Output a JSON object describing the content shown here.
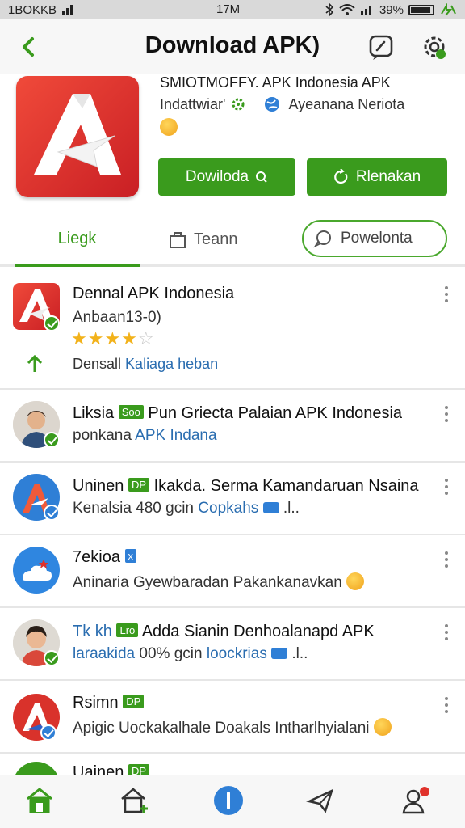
{
  "status_bar": {
    "left": "1BOKKB",
    "center": "17M",
    "right": "39%"
  },
  "app_bar": {
    "title": "Download APK)"
  },
  "app": {
    "name": "SMIOTMOFFY. APK Indonesia APK",
    "developer": "Indattwiar'",
    "category": "Ayeanana Neriota",
    "download_label": "Dowiloda",
    "rename_label": "Rlenakan"
  },
  "tabs": {
    "active": "Liegk",
    "team": "Teann",
    "pill": "Powelonta"
  },
  "list": [
    {
      "title": "Dennal APK Indonesia",
      "sub": "Anbaan13-0)",
      "rating": 4,
      "action": "Densall",
      "action_link": "Kaliaga heban"
    },
    {
      "title_a": "Liksia",
      "tag": "Soo",
      "title_b": "Pun Griecta Palaian APK Indonesia",
      "sub_a": "ponkana",
      "sub_b": "APK Indana"
    },
    {
      "title_a": "Uninen",
      "tag": "DP",
      "title_b": "Ikakda. Serma Kamandaruan Nsaina",
      "sub_a": "Kenalsia 480 gcin",
      "sub_b": "Copkahs",
      "sub_c": ".l.."
    },
    {
      "title_a": "7ekioa",
      "tag": "x",
      "sub": "Aninaria Gyewbaradan Pakankanavkan"
    },
    {
      "title_a": "Tk kh",
      "tag": "Lro",
      "title_b": "Adda Sianin Denhoalanapd APK",
      "sub_a": "laraakida",
      "sub_b": "00% gcin",
      "sub_c": "loockrias",
      "sub_d": ".l.."
    },
    {
      "title_a": "Rsimn",
      "tag": "DP",
      "sub": "Apigic Uockakalhale Doakals Intharlhyialani"
    },
    {
      "title_a": "Uainen",
      "tag": "DP"
    }
  ],
  "colors": {
    "accent": "#3a9b1d",
    "link": "#2a6db0",
    "brand_red": "#e0322b"
  }
}
